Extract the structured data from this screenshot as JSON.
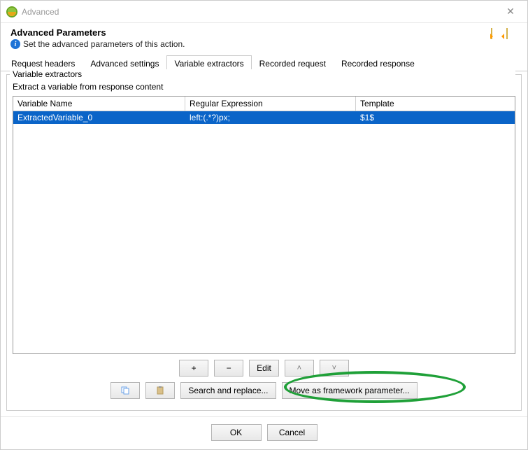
{
  "window": {
    "title": "Advanced"
  },
  "header": {
    "title": "Advanced Parameters",
    "subtitle": "Set the advanced parameters of this action."
  },
  "tabs": [
    {
      "label": "Request headers",
      "active": false
    },
    {
      "label": "Advanced settings",
      "active": false
    },
    {
      "label": "Variable extractors",
      "active": true
    },
    {
      "label": "Recorded request",
      "active": false
    },
    {
      "label": "Recorded response",
      "active": false
    }
  ],
  "group": {
    "title": "Variable extractors",
    "description": "Extract a variable from response content"
  },
  "table": {
    "columns": {
      "name": "Variable Name",
      "regex": "Regular Expression",
      "template": "Template"
    },
    "rows": [
      {
        "name": "ExtractedVariable_0",
        "regex": "left:(.*?)px;",
        "template": "$1$",
        "selected": true
      }
    ]
  },
  "toolbar": {
    "add": "+",
    "remove": "−",
    "edit": "Edit",
    "copy": "",
    "paste": "",
    "search_replace": "Search and replace...",
    "move_framework": "Move as framework parameter..."
  },
  "footer": {
    "ok": "OK",
    "cancel": "Cancel"
  }
}
